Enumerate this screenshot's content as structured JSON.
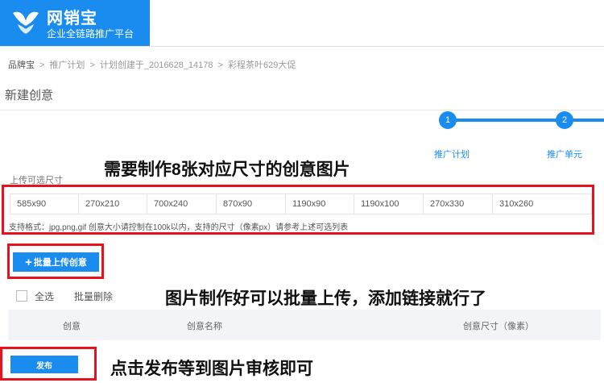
{
  "logo": {
    "brand": "网销宝",
    "slogan": "企业全链路推广平台"
  },
  "breadcrumb": [
    "品牌宝",
    "推广计划",
    "计划创建于_2016628_14178",
    "彩程茶叶629大促"
  ],
  "breadcrumb_separator": ">",
  "page_title": "新建创意",
  "steps": [
    {
      "number": "1",
      "label": "推广计划"
    },
    {
      "number": "2",
      "label": "推广单元"
    }
  ],
  "annotations": {
    "make_images": "需要制作8张对应尺寸的创意图片",
    "batch_upload": "图片制作好可以批量上传，添加链接就行了",
    "publish": "点击发布等到图片审核即可"
  },
  "upload": {
    "label": "上传可选尺寸",
    "sizes": [
      "585x90",
      "270x210",
      "700x240",
      "870x90",
      "1190x90",
      "1190x100",
      "270x330",
      "310x260"
    ],
    "format_note": "支持格式：jpg,png,gif 创意大小请控制在100k以内，支持的尺寸（像素px）请参考上述可选列表"
  },
  "batch_upload_button": {
    "icon": "plus-icon",
    "plus": "+",
    "label": "批量上传创意"
  },
  "select_all": "全选",
  "batch_delete": "批量删除",
  "table_headers": [
    "创意",
    "创意名称",
    "创意尺寸（像素）"
  ],
  "publish_button": "发布",
  "colors": {
    "accent": "#1a8cf0",
    "highlight": "#e8121e",
    "header_bg": "#f2f4f7"
  }
}
